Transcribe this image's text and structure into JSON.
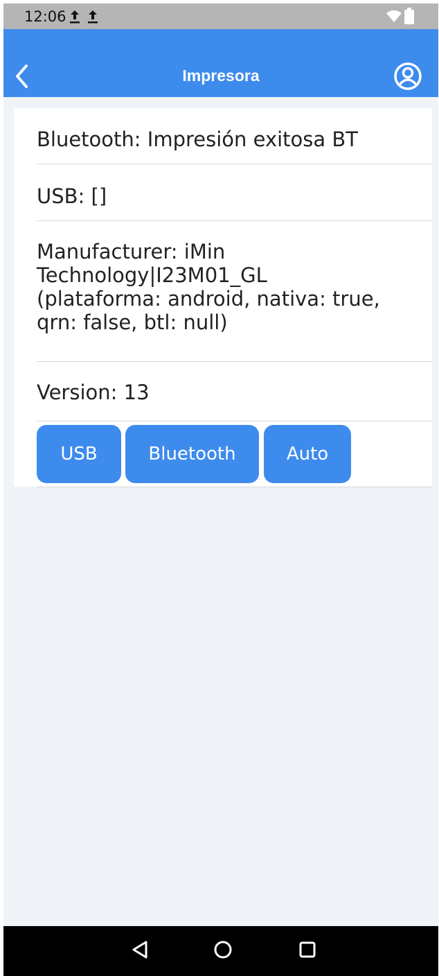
{
  "status_bar": {
    "time": "12:06",
    "icons": [
      "upload-icon",
      "upload-icon",
      "wifi-icon",
      "battery-icon"
    ]
  },
  "app_bar": {
    "title": "Impresora",
    "back_icon": "chevron-left-icon",
    "account_icon": "account-circle-icon",
    "color": "#3e8bee"
  },
  "info": {
    "bluetooth": "Bluetooth: Impresión exitosa BT",
    "usb": "USB: []",
    "manufacturer_line1": "Manufacturer: iMin",
    "manufacturer_line2": "Technology|I23M01_GL",
    "manufacturer_line3": "(plataforma: android, nativa: true,",
    "manufacturer_line4": "qrn: false, btl: null)",
    "version": "Version: 13"
  },
  "buttons": {
    "usb": "USB",
    "bluetooth": "Bluetooth",
    "auto": "Auto"
  },
  "nav_bar": {
    "icons": [
      "back-triangle-icon",
      "home-circle-icon",
      "recents-square-icon"
    ]
  }
}
